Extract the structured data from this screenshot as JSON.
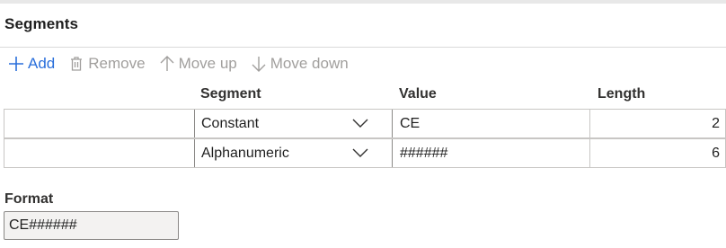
{
  "section": {
    "title": "Segments"
  },
  "toolbar": {
    "add": {
      "label": "Add",
      "icon": "plus-icon",
      "enabled": true
    },
    "remove": {
      "label": "Remove",
      "icon": "trash-icon",
      "enabled": false
    },
    "move_up": {
      "label": "Move up",
      "icon": "arrow-up-icon",
      "enabled": false
    },
    "move_down": {
      "label": "Move down",
      "icon": "arrow-down-icon",
      "enabled": false
    }
  },
  "grid": {
    "columns": [
      "Segment",
      "Value",
      "Length"
    ],
    "rows": [
      {
        "segment": "Constant",
        "value": "CE",
        "length": "2"
      },
      {
        "segment": "Alphanumeric",
        "value": "######",
        "length": "6"
      }
    ]
  },
  "format": {
    "label": "Format",
    "value": "CE######"
  },
  "colors": {
    "accent": "#2a6fdb",
    "disabled": "#a19f9d",
    "border": "#c8c6c4",
    "readonly_bg": "#f3f2f1"
  }
}
